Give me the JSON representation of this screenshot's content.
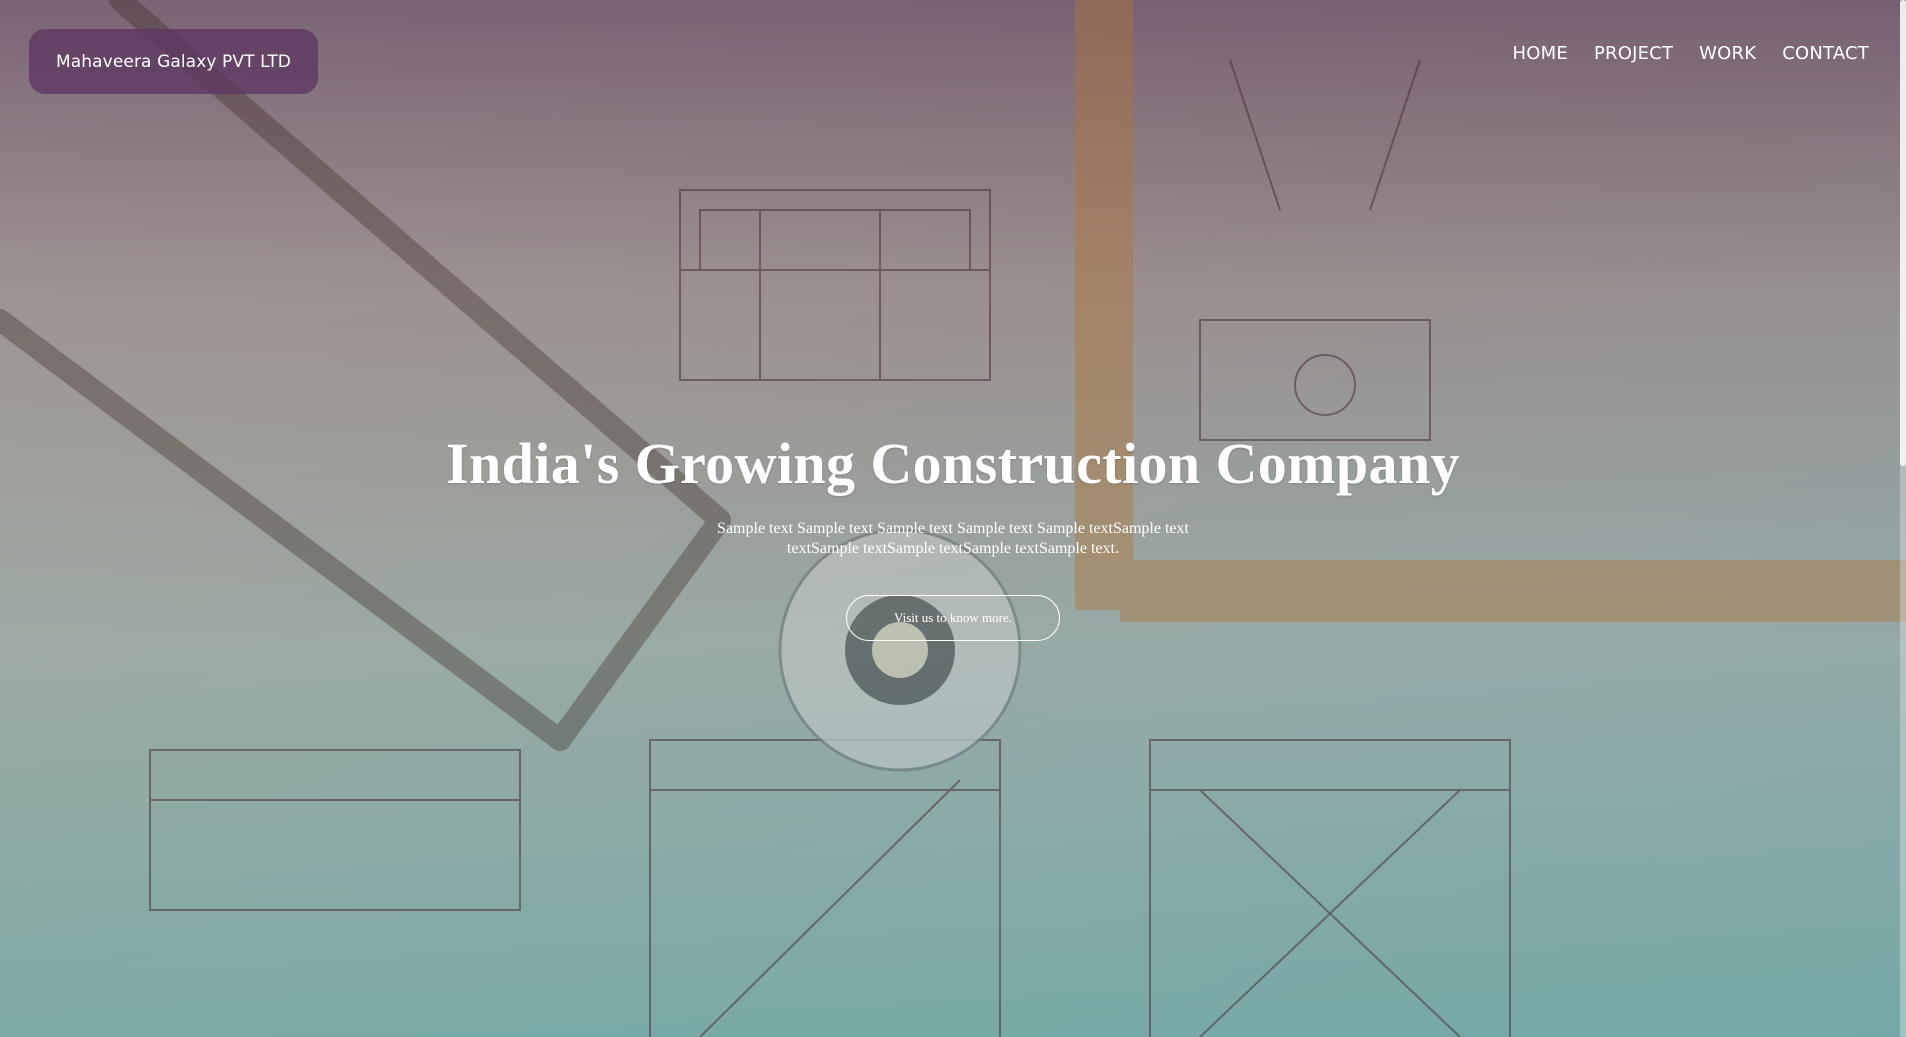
{
  "brand": {
    "name": "Mahaveera Galaxy PVT LTD"
  },
  "nav": {
    "items": [
      {
        "label": "HOME"
      },
      {
        "label": "PROJECT"
      },
      {
        "label": "WORK"
      },
      {
        "label": "CONTACT"
      }
    ]
  },
  "hero": {
    "title": "India's Growing Construction Company",
    "subtitle": "Sample text Sample text Sample text Sample text Sample textSample text textSample textSample textSample textSample text.",
    "cta_label": "Visit us to know more."
  },
  "colors": {
    "brand_pill": "#5c3762",
    "text": "#ffffff",
    "overlay_top": "#563a56",
    "overlay_bottom": "#549a96"
  },
  "icons": {
    "background": "blueprint-illustration"
  }
}
